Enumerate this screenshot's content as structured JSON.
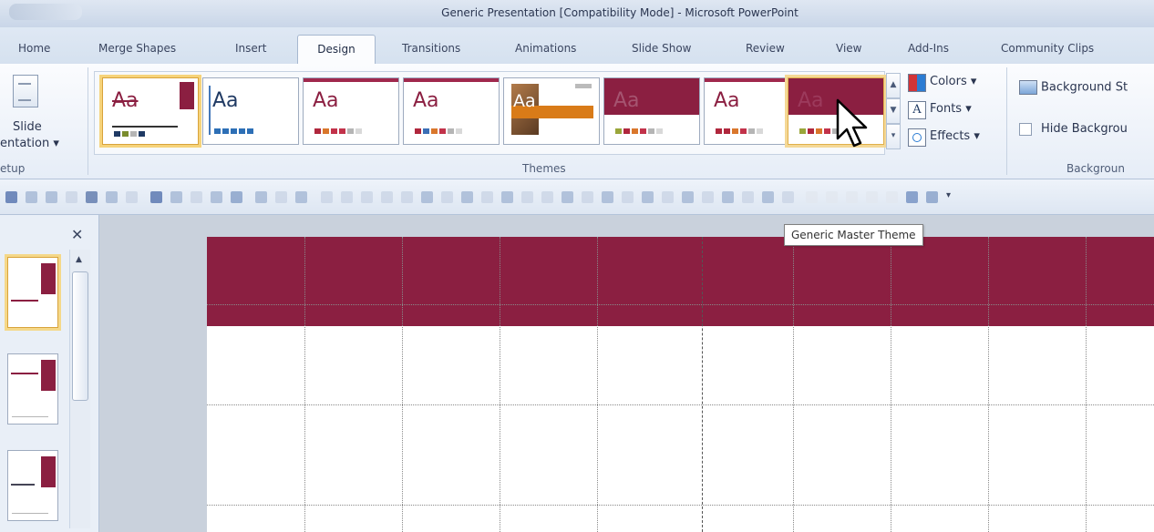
{
  "window": {
    "title": "Generic Presentation [Compatibility Mode] - Microsoft PowerPoint"
  },
  "tabs": [
    {
      "label": "Home"
    },
    {
      "label": "Merge Shapes"
    },
    {
      "label": "Insert"
    },
    {
      "label": "Design",
      "active": true
    },
    {
      "label": "Transitions"
    },
    {
      "label": "Animations"
    },
    {
      "label": "Slide Show"
    },
    {
      "label": "Review"
    },
    {
      "label": "View"
    },
    {
      "label": "Add-Ins"
    },
    {
      "label": "Community Clips"
    }
  ],
  "ribbon": {
    "page_setup": {
      "line1": "Slide",
      "line2": "entation ▾",
      "group_label": "etup"
    },
    "themes": {
      "group_label": "Themes",
      "items": [
        {
          "aa": "Aa",
          "state": "selected"
        },
        {
          "aa": "Aa"
        },
        {
          "aa": "Aa"
        },
        {
          "aa": "Aa"
        },
        {
          "aa": "Aa",
          "kind": "photo"
        },
        {
          "aa": "Aa",
          "kind": "dark"
        },
        {
          "aa": "Aa"
        },
        {
          "aa": "Aa",
          "kind": "dark",
          "state": "hovered"
        }
      ]
    },
    "theme_options": {
      "colors_label": "Colors ▾",
      "fonts_label": "Fonts ▾",
      "effects_label": "Effects ▾"
    },
    "background": {
      "styles_label": "Background St",
      "hide_label": "Hide Backgrou",
      "group_label": "Backgroun"
    }
  },
  "tooltip": {
    "text": "Generic Master Theme"
  },
  "colors": {
    "accent": "#8b1f41",
    "ribbon_bg": "#e6edf7",
    "selection": "#f6d37a"
  }
}
